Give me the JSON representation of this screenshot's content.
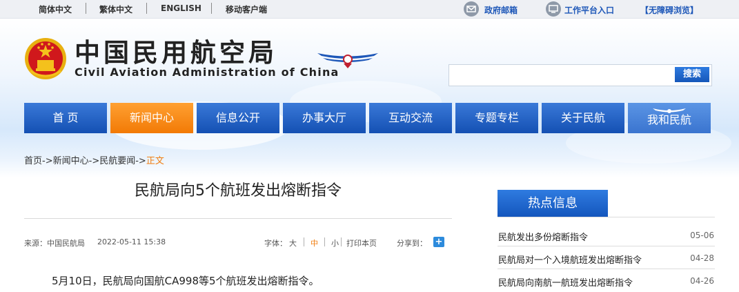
{
  "topbar": {
    "languages": [
      "简体中文",
      "繁体中文",
      "ENGLISH",
      "移动客户端"
    ],
    "gov_mail": "政府邮箱",
    "work_portal": "工作平台入口",
    "accessibility": "【无障碍浏览】"
  },
  "header": {
    "title_cn": "中国民用航空局",
    "title_en": "Civil Aviation Administration of China",
    "search_placeholder": "",
    "search_button": "搜索"
  },
  "nav": {
    "items": [
      "首 页",
      "新闻中心",
      "信息公开",
      "办事大厅",
      "互动交流",
      "专题专栏",
      "关于民航",
      "我和民航"
    ],
    "active_index": 1
  },
  "breadcrumb": {
    "home": "首页",
    "news": "新闻中心",
    "section": "民航要闻",
    "current": "正文",
    "arrow": "->"
  },
  "article": {
    "title": "民航局向5个航班发出熔断指令",
    "source": "来源：中国民航局",
    "datetime": "2022-05-11 15:38",
    "font_label": "字体：",
    "font_large": "大",
    "font_medium": "中",
    "font_small": "小",
    "print": "打印本页",
    "share": "分享到：",
    "body": "5月10日，民航局向国航CA998等5个航班发出熔断指令。"
  },
  "hot": {
    "title": "热点信息",
    "items": [
      {
        "title": "民航发出多份熔断指令",
        "date": "05-06"
      },
      {
        "title": "民航局对一个入境航班发出熔断指令",
        "date": "04-28"
      },
      {
        "title": "民航局向南航一航班发出熔断指令",
        "date": "04-26"
      }
    ]
  },
  "colors": {
    "nav_blue": "#1f5fc4",
    "nav_active": "#f58a17",
    "link_blue": "#1d57b8",
    "breadcrumb_current": "#f07d10"
  }
}
